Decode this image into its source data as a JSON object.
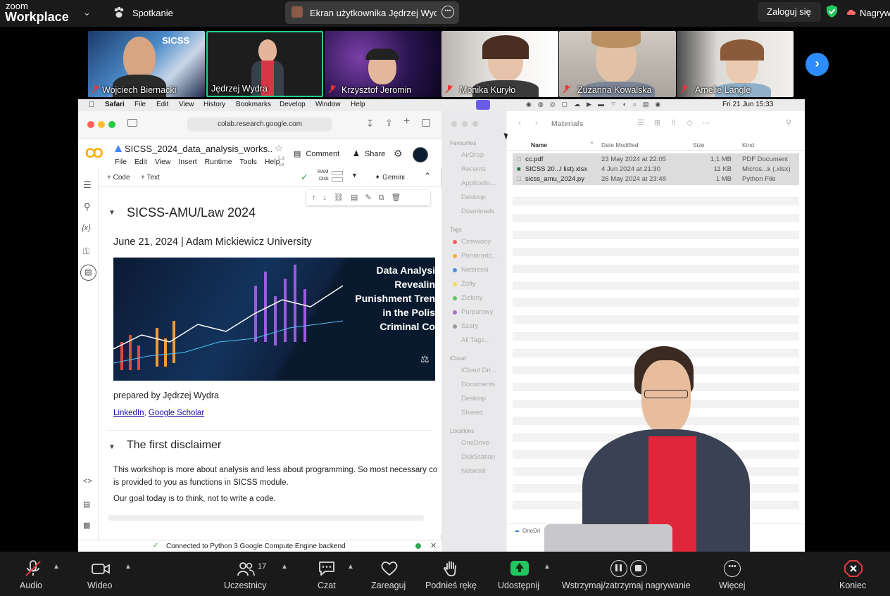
{
  "zoom_top": {
    "logo_line1": "zoom",
    "logo_line2": "Workplace",
    "meeting_label": "Spotkanie",
    "share_label": "Ekran użytkownika Jędrzej Wydra",
    "login_label": "Zaloguj się",
    "record_label": "Nagrywanie"
  },
  "participants": [
    {
      "name": "Wojciech Biernacki",
      "muted": true
    },
    {
      "name": "Jędrzej Wydra",
      "muted": false,
      "active_speaker": true
    },
    {
      "name": "Krzysztof Jeromin",
      "muted": true
    },
    {
      "name": "Monika Kuryło",
      "muted": true
    },
    {
      "name": "Zuzanna Kowalska",
      "muted": true
    },
    {
      "name": "Amelie Längle",
      "muted": true
    }
  ],
  "tile_overlay_text": "SICSS",
  "mac_menu": {
    "app": "Safari",
    "items": [
      "File",
      "Edit",
      "View",
      "History",
      "Bookmarks",
      "Develop",
      "Window",
      "Help"
    ],
    "clock": "Fri 21 Jun  15:33"
  },
  "safari": {
    "url": "colab.research.google.com"
  },
  "colab": {
    "title": "SICSS_2024_data_analysis_works...",
    "menu": [
      "File",
      "Edit",
      "View",
      "Insert",
      "Runtime",
      "Tools",
      "Help"
    ],
    "menu_extra": "La sa",
    "comment_label": "Comment",
    "share_label": "Share",
    "add_code": "+ Code",
    "add_text": "+ Text",
    "ram_label": "RAM",
    "disk_label": "Disk",
    "gemini_label": "Gemini",
    "h1": "SICSS-AMU/Law 2024",
    "subtitle": "June 21, 2024 | Adam Mickiewicz University",
    "banner_lines": [
      "Data Analysi",
      "Revealin",
      "Punishment Tren",
      "in the Polis",
      "Criminal Co"
    ],
    "prepared_by": "prepared by Jędrzej Wydra",
    "link1": "LinkedIn",
    "link_sep": ",",
    "link2": "Google Scholar",
    "h2": "The first disclaimer",
    "para1": "This workshop is more about analysis and less about programming. So most necessary co",
    "para1b": "is provided to you as functions in SICSS module.",
    "para2": "Our goal today is to think, not to write a code.",
    "status": "Connected to Python 3 Google Compute Engine backend"
  },
  "finder": {
    "title": "Materials",
    "sidebar": {
      "favourites_hdr": "Favourites",
      "favourites": [
        "AirDrop",
        "Recents",
        "Applicatio...",
        "Desktop",
        "Downloads"
      ],
      "tags_hdr": "Tags",
      "tags": [
        {
          "name": "Czerwony",
          "color": "#ff5f57"
        },
        {
          "name": "Pomarańc...",
          "color": "#ffaa33"
        },
        {
          "name": "Niebieski",
          "color": "#4a90e2"
        },
        {
          "name": "Żółty",
          "color": "#ffd84d"
        },
        {
          "name": "Zielony",
          "color": "#5ac85a"
        },
        {
          "name": "Purpurowy",
          "color": "#b36ad9"
        },
        {
          "name": "Szary",
          "color": "#999999"
        }
      ],
      "all_tags": "All Tags...",
      "icloud_hdr": "iCloud",
      "icloud": [
        "iCloud Dri...",
        "Documents",
        "Desktop",
        "Shared"
      ],
      "locations_hdr": "Locations",
      "locations": [
        "OneDrive",
        "DiskStation",
        "Network"
      ]
    },
    "columns": [
      "Name",
      "Date Modified",
      "Size",
      "Kind"
    ],
    "files": [
      {
        "name": "cc.pdf",
        "date": "23 May 2024 at 22:05",
        "size": "1,1 MB",
        "kind": "PDF Document"
      },
      {
        "name": "SICSS 20...l list).xlsx",
        "date": "4 Jun 2024 at 21:30",
        "size": "11 KB",
        "kind": "Micros...k (.xlsx)"
      },
      {
        "name": "sicss_amu_2024.py",
        "date": "26 May 2024 at 23:48",
        "size": "1 MB",
        "kind": "Python File"
      }
    ],
    "path": "OneDri"
  },
  "toolbar": {
    "audio": "Audio",
    "video": "Wideo",
    "participants": "Uczestnicy",
    "participants_count": "17",
    "chat": "Czat",
    "react": "Zareaguj",
    "raise_hand": "Podnieś rękę",
    "share": "Udostępnij",
    "pause_rec": "Wstrzymaj/zatrzymaj nagrywanie",
    "more": "Więcej",
    "end": "Koniec"
  },
  "colors": {
    "zoom_blue": "#2d8cff",
    "active_border": "#23d18b",
    "share_green": "#22c55e",
    "end_red": "#e0393e"
  }
}
